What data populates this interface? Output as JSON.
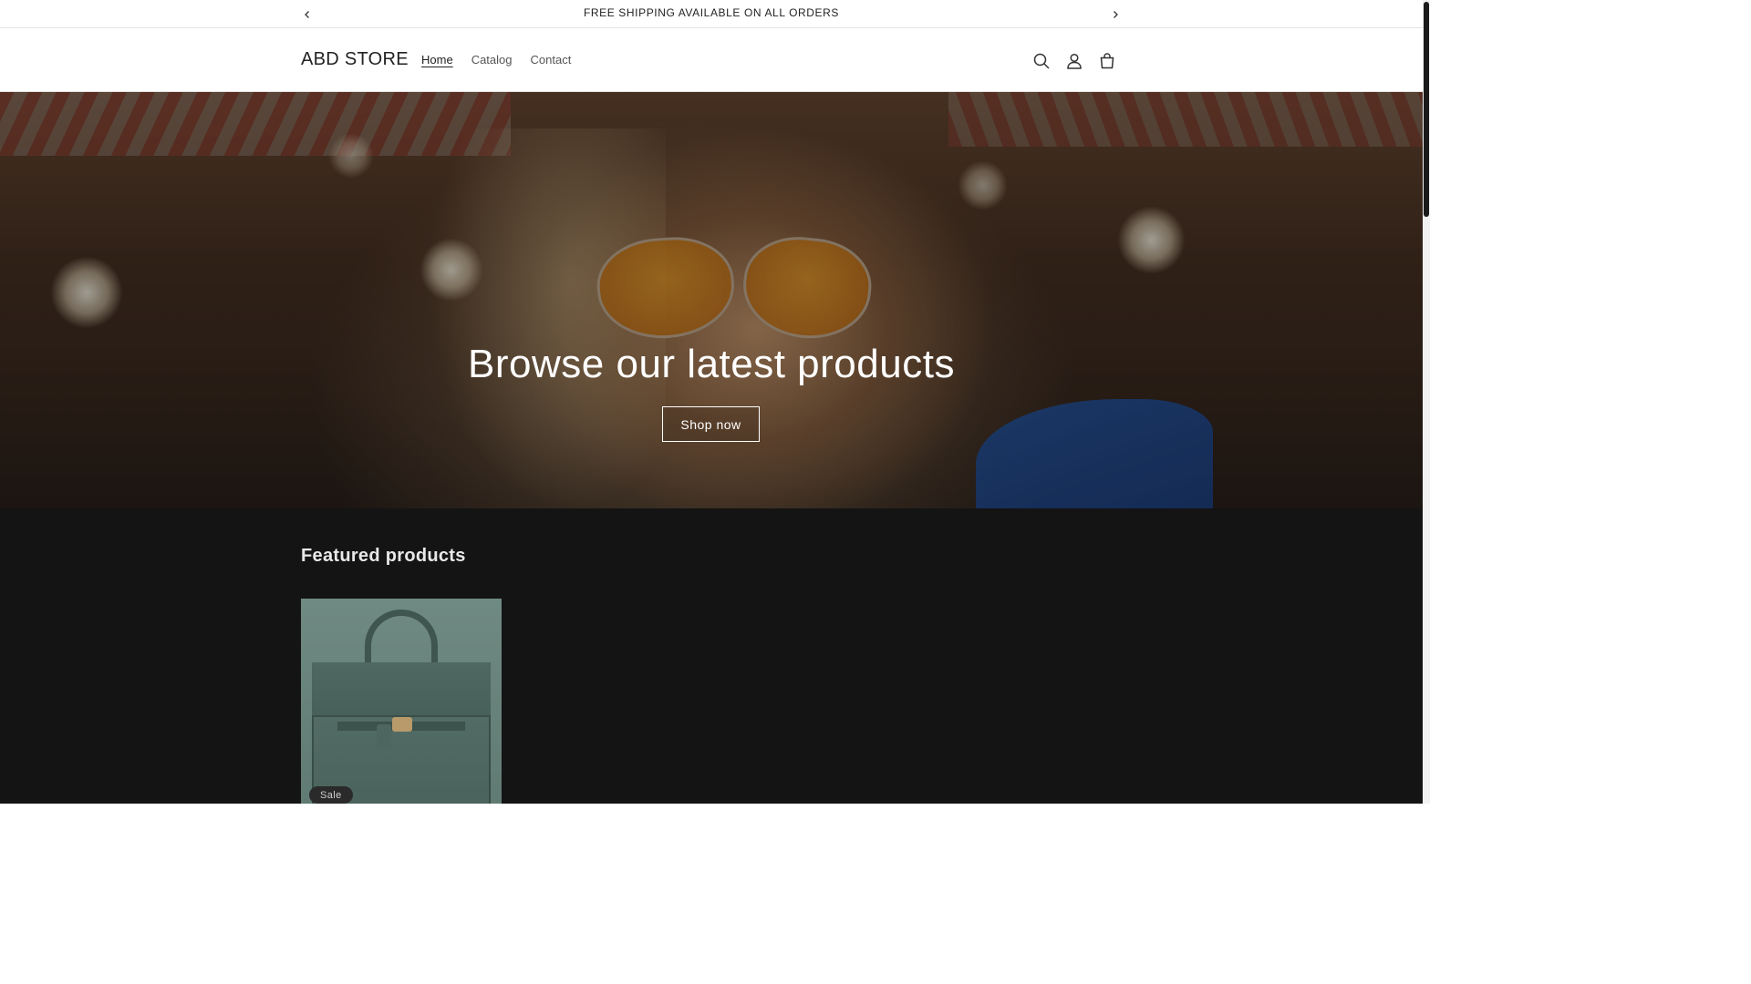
{
  "announcement": {
    "text": "FREE SHIPPING AVAILABLE ON ALL ORDERS",
    "prev_icon": "chevron-left-icon",
    "next_icon": "chevron-right-icon"
  },
  "header": {
    "logo": "ABD STORE",
    "nav": [
      {
        "label": "Home",
        "active": true
      },
      {
        "label": "Catalog",
        "active": false
      },
      {
        "label": "Contact",
        "active": false
      }
    ],
    "icons": [
      "search-icon",
      "account-icon",
      "cart-icon"
    ]
  },
  "hero": {
    "title": "Browse our latest products",
    "button_label": "Shop now"
  },
  "featured": {
    "title": "Featured products",
    "products": [
      {
        "badge": "Sale",
        "image": "handbag"
      }
    ]
  },
  "colors": {
    "featured_bg": "#141414",
    "text_dark": "#222222"
  }
}
